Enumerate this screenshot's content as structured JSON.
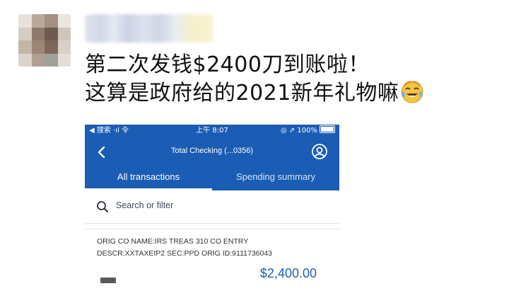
{
  "post": {
    "line1": "第二次发钱$2400刀到账啦！",
    "line2": "这算是政府给的2021新年礼物嘛",
    "emoji": "face-with-tears-of-joy-icon"
  },
  "phone": {
    "status": {
      "left": "◀ 搜索 ·ıl 令",
      "time": "上午 8:07",
      "right": "◎ ⇗ 100%"
    },
    "nav": {
      "title": "Total Checking  (...0356)"
    },
    "tabs": [
      {
        "label": "All transactions",
        "active": true
      },
      {
        "label": "Spending summary",
        "active": false
      }
    ],
    "search": {
      "placeholder": "Search or filter"
    },
    "transaction": {
      "line1": "ORIG CO NAME:IRS TREAS 310 CO ENTRY",
      "line2": "DESCR:XXTAXEIP2 SEC:PPD ORIG ID:9111736043",
      "amount": "$2,400.00"
    }
  },
  "colors": {
    "appbar": "#1b5cb4",
    "amount": "#1c5fb6",
    "text": "#111111"
  }
}
